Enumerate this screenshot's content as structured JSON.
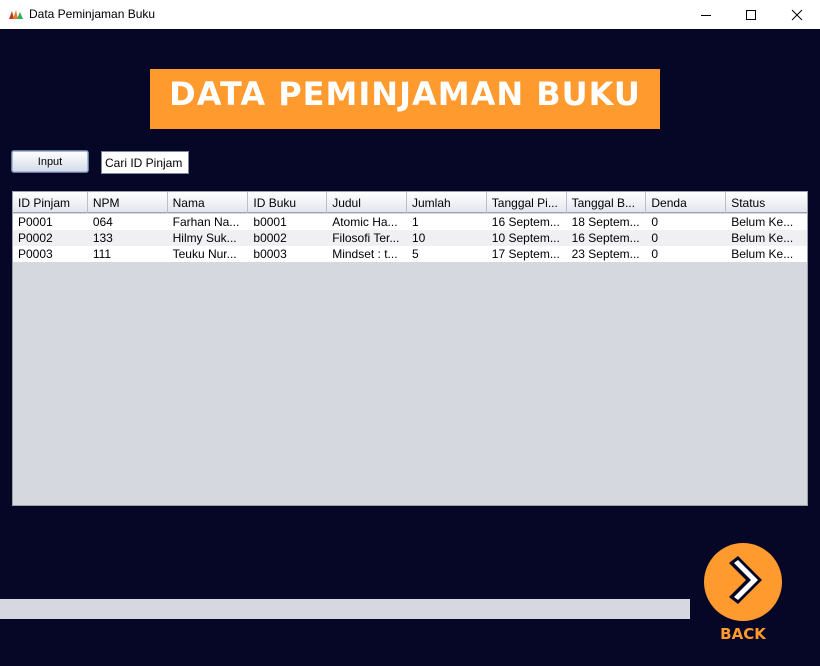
{
  "window": {
    "title": "Data Peminjaman Buku",
    "icon": "java-cup-icon",
    "controls": [
      "minimize",
      "maximize",
      "close"
    ]
  },
  "banner": {
    "text": "DATA PEMINJAMAN BUKU",
    "color": "#ff9a2e"
  },
  "toolbar": {
    "input_label": "Input",
    "search_value": "Cari ID Pinjam"
  },
  "table": {
    "columns": [
      "ID Pinjam",
      "NPM",
      "Nama",
      "ID Buku",
      "Judul",
      "Jumlah",
      "Tanggal Pi...",
      "Tanggal B...",
      "Denda",
      "Status"
    ],
    "rows": [
      [
        "P0001",
        "064",
        "Farhan Na...",
        "b0001",
        "Atomic Ha...",
        "1",
        "16 Septem...",
        "18 Septem...",
        "0",
        "Belum Ke..."
      ],
      [
        "P0002",
        "133",
        "Hilmy Suk...",
        "b0002",
        "Filosofi Ter...",
        "10",
        "10 Septem...",
        "16 Septem...",
        "0",
        "Belum Ke..."
      ],
      [
        "P0003",
        "111",
        "Teuku Nur...",
        "b0003",
        "Mindset : t...",
        "5",
        "17 Septem...",
        "23 Septem...",
        "0",
        "Belum Ke..."
      ]
    ]
  },
  "back": {
    "label": "BACK",
    "icon": "chevron-right-icon",
    "color": "#ff9a2e"
  },
  "colors": {
    "background": "#060626",
    "accent": "#ff9a2e",
    "panel": "#d5d8df"
  }
}
